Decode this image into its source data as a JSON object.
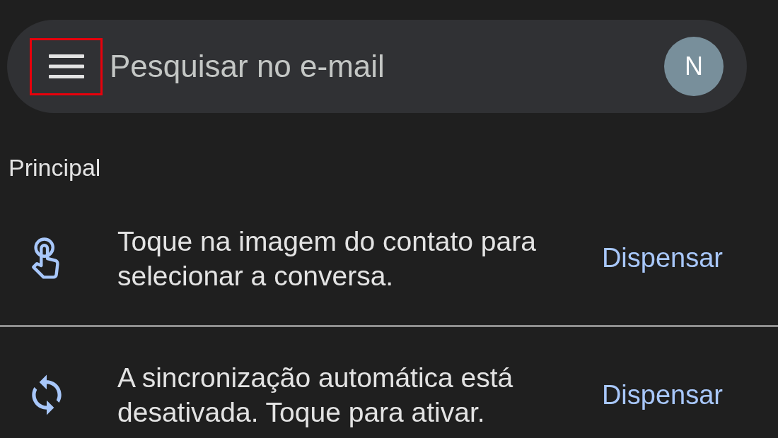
{
  "search_bar": {
    "menu_highlighted": true,
    "placeholder": "Pesquisar no e-mail",
    "avatar_initial": "N"
  },
  "section_label": "Principal",
  "tips": [
    {
      "kind": "touch",
      "text": "Toque na imagem do contato para selecionar a conversa.",
      "action": "Dispensar"
    },
    {
      "kind": "sync",
      "text": "A sincronização automática está desativada. Toque para ativar.",
      "action": "Dispensar"
    }
  ]
}
